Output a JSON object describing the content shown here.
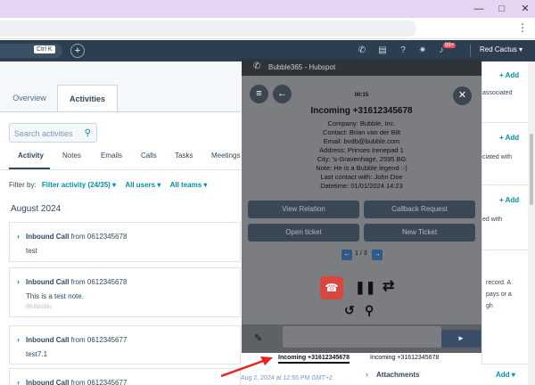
{
  "browser": {
    "window_controls": [
      "—",
      "□",
      "✕"
    ],
    "menu_glyph": "⋮"
  },
  "hubspot_nav": {
    "search_shortcut": "Ctrl K",
    "add_glyph": "+",
    "notification_count": "99+",
    "user_name": "Red Cactus"
  },
  "record_tabs": [
    {
      "label": "Overview"
    },
    {
      "label": "Activities"
    }
  ],
  "activities": {
    "search_placeholder": "Search activities",
    "subtabs": [
      "Activity",
      "Notes",
      "Emails",
      "Calls",
      "Tasks",
      "Meetings"
    ],
    "filter_label": "Filter by:",
    "filter_activity": "Filter activity (24/35)",
    "filter_users": "All users",
    "filter_teams": "All teams",
    "month_heading": "August 2024",
    "items": [
      {
        "type": "Inbound Call",
        "from_label": "from",
        "number": "0612345678",
        "body": "test",
        "extra": ""
      },
      {
        "type": "Inbound Call",
        "from_label": "from",
        "number": "0612345678",
        "body": "This is a test note.",
        "extra": "Blublublu"
      },
      {
        "type": "Inbound Call",
        "from_label": "from",
        "number": "0612345677",
        "body": "test7.1",
        "extra": ""
      },
      {
        "type": "Inbound Call",
        "from_label": "from",
        "number": "0612345677",
        "body": "",
        "extra": ""
      }
    ],
    "last_timestamp": "Aug 2, 2024 at 12:55 PM GMT+2"
  },
  "right_panel": {
    "add_label": "+ Add",
    "snippets": [
      "associated",
      "ciated with",
      "ed with",
      "record. A",
      "pays or a",
      "gh"
    ],
    "attachments_label": "Attachments",
    "attachments_add": "Add"
  },
  "softphone": {
    "title": "Bubble365 - Hubspot",
    "timer": "00:15",
    "incoming_title": "Incoming +31612345678",
    "info": [
      "Company: Bubble, Inc.",
      "Contact: Brian van der Bilt",
      "Email: bvdb@bubble.com",
      "Address: Prinses Irenepad 1",
      "City: 's-Gravenhage, 2595 BG",
      "Note: He is a Bubble legend :-)",
      "Last contact with: John Doe",
      "Datetime: 01/01/2024 14:23"
    ],
    "buttons": {
      "view_relation": "View Relation",
      "callback_request": "Callback Request",
      "open_ticket": "Open ticket",
      "new_ticket": "New Ticket"
    },
    "pager": "1 / 3",
    "message_placeholder": "...",
    "call_tabs": [
      "Incoming +31612345678",
      "Incoming +31612345678"
    ]
  },
  "colors": {
    "hubspot_nav": "#2d3e50",
    "link": "#0091ae",
    "phone_header": "#2f3439",
    "phone_body": "#7b7d80",
    "hangup": "#d9463e",
    "annotation_arrow": "#e8231e"
  }
}
